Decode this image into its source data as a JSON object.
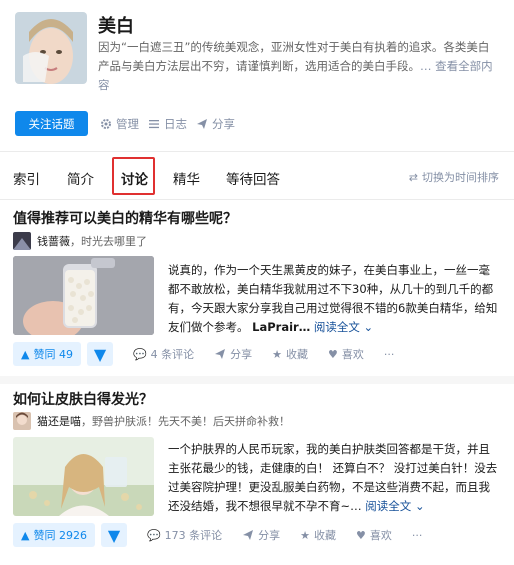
{
  "topic": {
    "title": "美白",
    "description": "因为“一白遮三丑”的传统美观念，亚洲女性对于美白有执着的追求。各类美白产品与美白方法层出不穷，请谨慎判断，选用适合的美白手段。",
    "more_link": "… 查看全部内容",
    "follow_label": "关注话题",
    "manage_label": "管理",
    "log_label": "日志",
    "share_label": "分享"
  },
  "tabs": [
    "索引",
    "简介",
    "讨论",
    "精华",
    "等待回答"
  ],
  "active_tab": "讨论",
  "sort_toggle": "切换为时间排序",
  "feed": [
    {
      "question": "值得推荐可以美白的精华有哪些呢？",
      "author": "钱蔷薇",
      "author_bio": "，时光去哪里了",
      "excerpt": "说真的，作为一个天生黑黄皮的妹子，在美白事业上，一丝一毫都不敢放松，美白精华我就用过不下30种，从几十的到几千的都有，今天跟大家分享我自己用过觉得很不错的6款美白精华，给知友们做个参考。",
      "excerpt_tail": "LaPrair…",
      "read_more": "阅读全文 ⌄",
      "votes": "赞同 49",
      "comments": "4 条评论",
      "share": "分享",
      "favorite": "收藏",
      "like": "喜欢",
      "more": "···"
    },
    {
      "question": "如何让皮肤白得发光？",
      "author": "猫还是喵",
      "author_bio": "，野兽护肤派！先天不美！后天拼命补救！",
      "excerpt": "一个护肤界的人民币玩家，我的美白护肤类回答都是干货，并且主张花最少的钱，走健康的白！ 还算白不？ 没打过美白针！没去过美容院护理！更没乱服美白药物，不是这些消费不起，而且我还没结婚，我不想很早就不孕不育~…",
      "read_more": "阅读全文 ⌄",
      "votes": "赞同 2926",
      "comments": "173 条评论",
      "share": "分享",
      "favorite": "收藏",
      "like": "喜欢",
      "more": "···"
    }
  ]
}
